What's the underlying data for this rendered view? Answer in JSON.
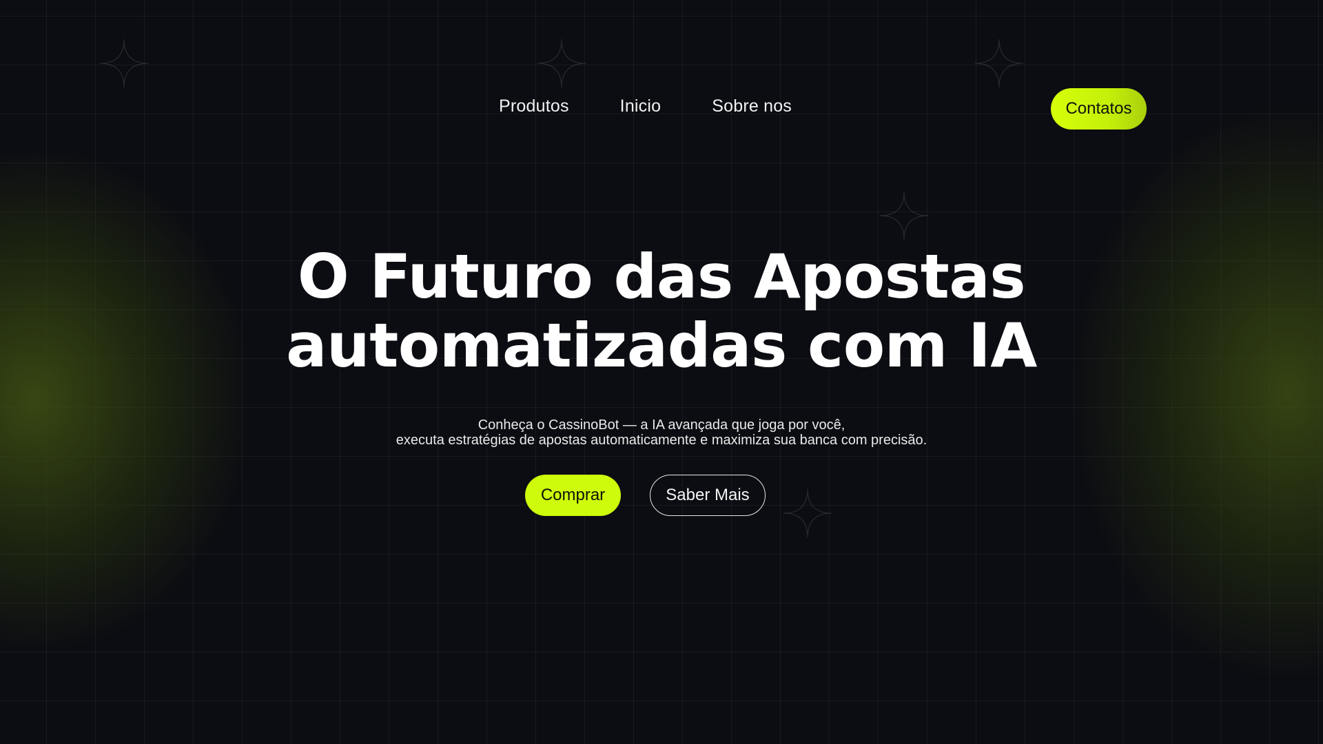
{
  "nav": {
    "items": [
      {
        "label": "Produtos"
      },
      {
        "label": "Inicio"
      },
      {
        "label": "Sobre nos"
      }
    ],
    "contact_label": "Contatos"
  },
  "hero": {
    "title_line1": "O Futuro das Apostas",
    "title_line2": "automatizadas com IA",
    "subtitle_line1": "Conheça o CassinoBot — a IA avançada que joga por você,",
    "subtitle_line2": "executa estratégias de apostas automaticamente e maximiza sua banca com precisão.",
    "primary_button": "Comprar",
    "secondary_button": "Saber Mais"
  },
  "theme": {
    "background": "#0c0d12",
    "accent": "#cdfb0b",
    "glow": "#465a12",
    "text": "#ffffff"
  },
  "decor": {
    "sparkle_icon": "four-point-star-icon"
  }
}
